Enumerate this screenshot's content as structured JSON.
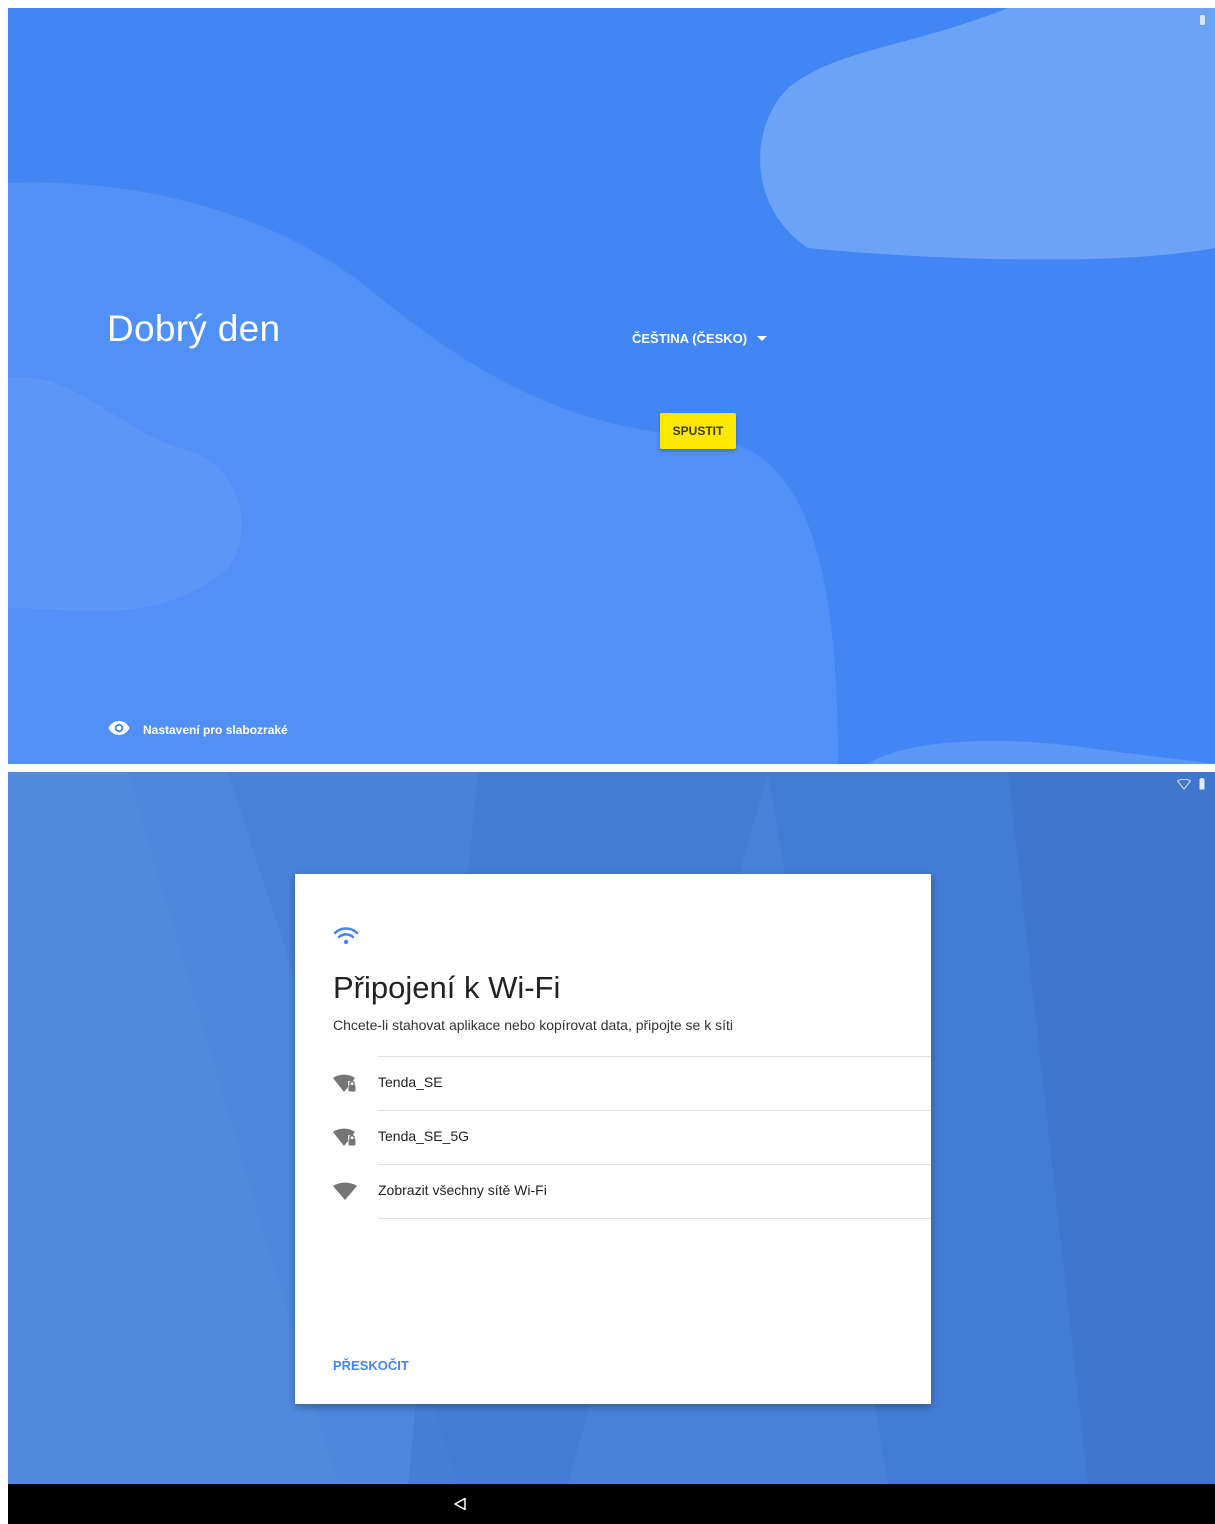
{
  "welcome": {
    "greeting": "Dobrý den",
    "language": "ČEŠTINA (ČESKO)",
    "start_label": "SPUSTIT",
    "accessibility_label": "Nastavení pro slabozraké"
  },
  "wifi": {
    "title": "Připojení k Wi-Fi",
    "subtitle": "Chcete-li stahovat aplikace nebo kopírovat data, připojte se k síti",
    "networks": [
      {
        "name": "Tenda_SE",
        "icon": "wifi-lock-icon"
      },
      {
        "name": "Tenda_SE_5G",
        "icon": "wifi-lock-icon"
      },
      {
        "name": "Zobrazit všechny sítě Wi-Fi",
        "icon": "wifi-icon"
      }
    ],
    "skip_label": "PŘESKOČIT"
  },
  "colors": {
    "welcome_bg": "#4286f4",
    "wifi_bg": "#4a82d9",
    "start_button": "#ffe700",
    "accent": "#4285f4"
  }
}
